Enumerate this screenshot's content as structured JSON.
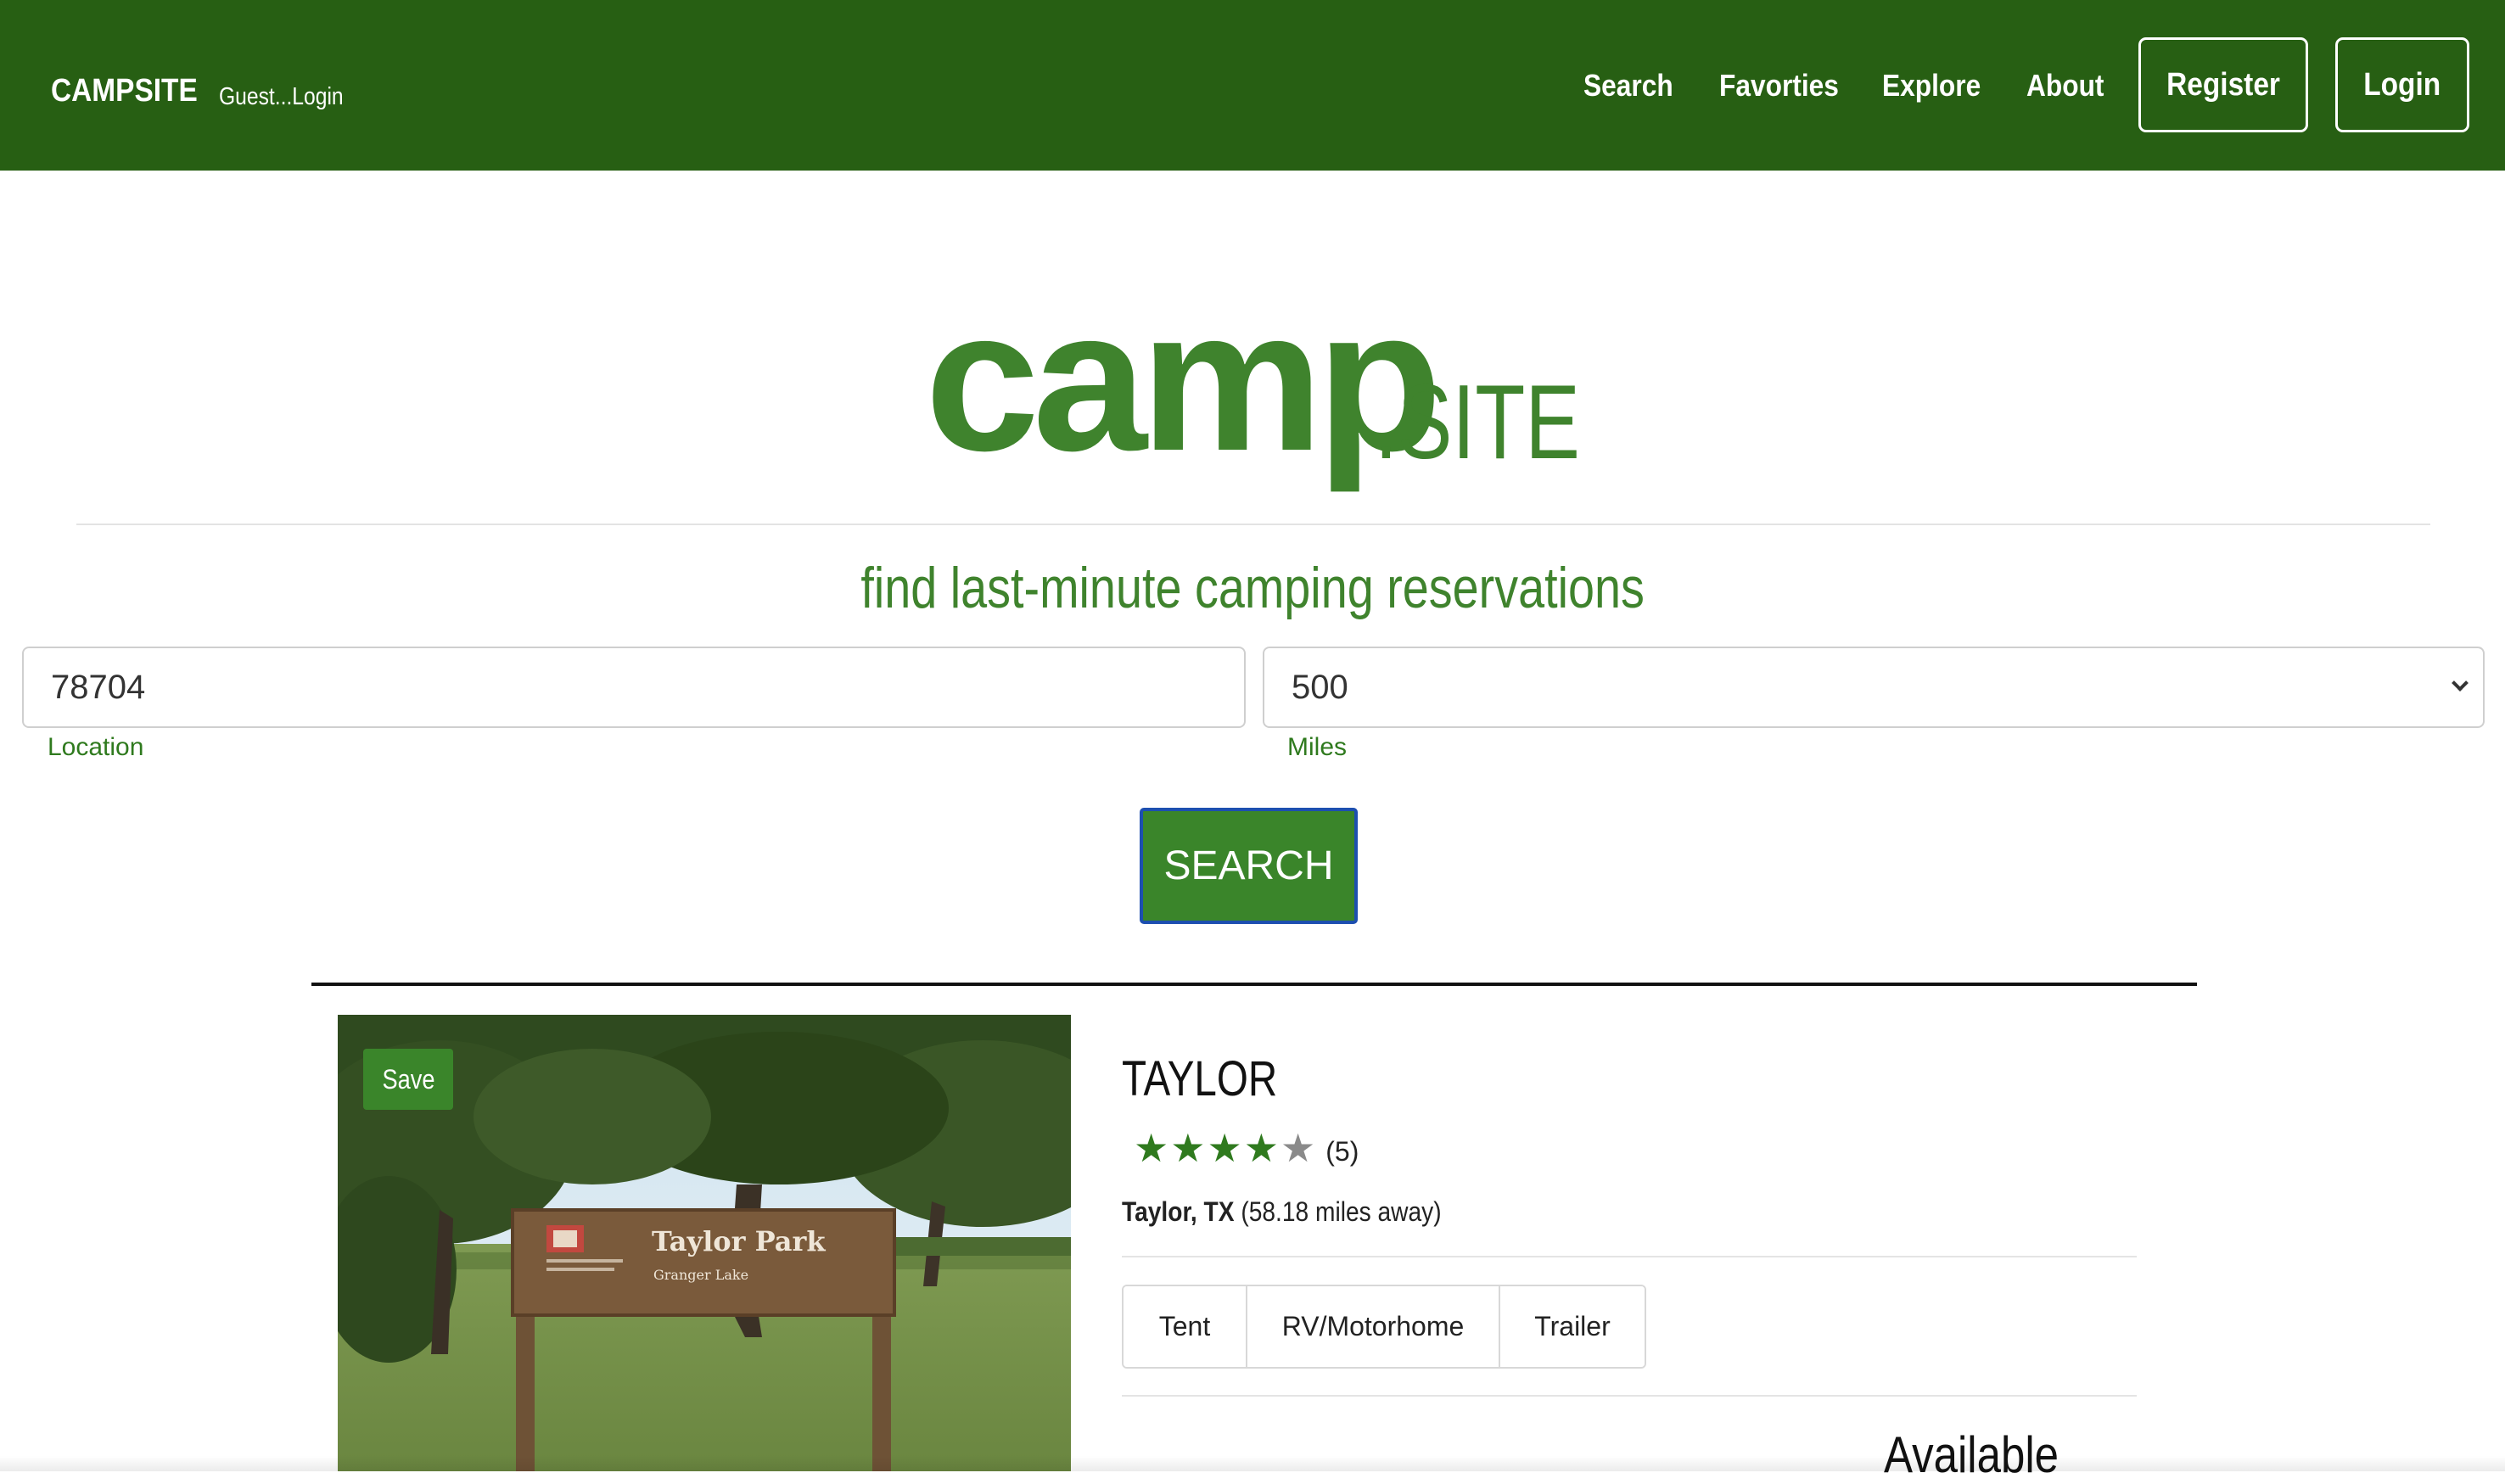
{
  "navbar": {
    "brand": "CAMPSITE",
    "guest_text": "Guest...Login",
    "links": [
      "Search",
      "Favorties",
      "Explore",
      "About"
    ],
    "register_label": "Register",
    "login_label": "Login",
    "background_color": "#275f13"
  },
  "hero": {
    "logo_main": "camp",
    "logo_suffix": ".SITE",
    "tagline": "find last-minute camping reservations",
    "accent_color": "#3f832d"
  },
  "search_form": {
    "location_value": "78704",
    "location_label": "Location",
    "miles_value": "500",
    "miles_label": "Miles",
    "search_button": "SEARCH"
  },
  "result": {
    "save_label": "Save",
    "name": "TAYLOR",
    "rating_stars": 4,
    "rating_max": 5,
    "rating_count": "(5)",
    "city": "Taylor, TX",
    "distance": "(58.18 miles away)",
    "types": [
      "Tent",
      "RV/Motorhome",
      "Trailer"
    ],
    "availability_heading": "Available",
    "photo_sign_title": "Taylor Park",
    "photo_sign_subtitle": "Granger Lake"
  }
}
